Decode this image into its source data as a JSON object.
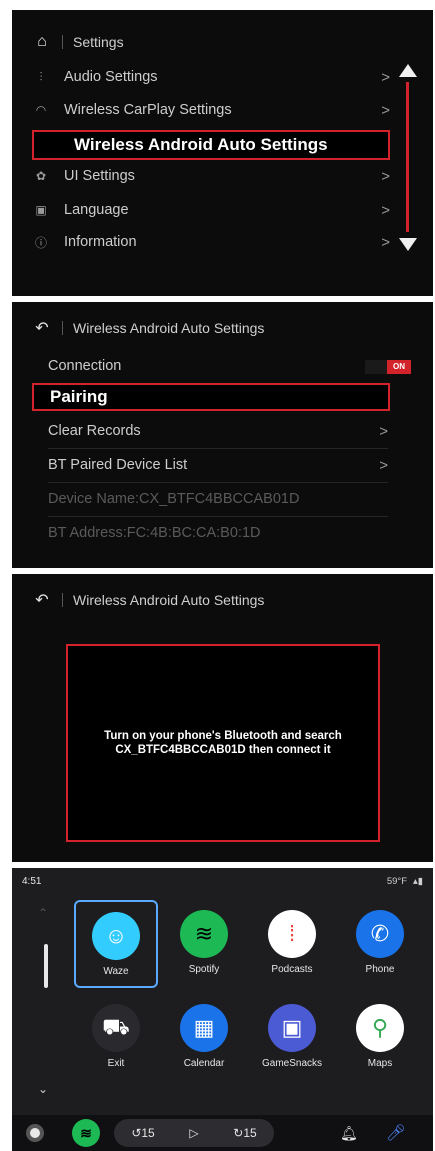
{
  "settings_panel": {
    "title": "Settings",
    "items": [
      {
        "label": "Audio Settings",
        "icon": "audio-icon",
        "chevron": ">"
      },
      {
        "label": "Wireless CarPlay Settings",
        "icon": "wifi-icon",
        "chevron": ">"
      },
      {
        "label": "Wireless Android Auto Settings",
        "icon": "",
        "chevron": ""
      },
      {
        "label": "UI Settings",
        "icon": "palette-icon",
        "chevron": ">"
      },
      {
        "label": "Language",
        "icon": "language-icon",
        "chevron": ">"
      },
      {
        "label": "Information",
        "icon": "info-icon",
        "chevron": ">"
      }
    ]
  },
  "aa_settings_panel": {
    "title": "Wireless Android Auto Settings",
    "connection_label": "Connection",
    "connection_toggle": "ON",
    "pairing_label": "Pairing",
    "clear_records_label": "Clear Records",
    "bt_list_label": "BT Paired Device List",
    "device_name": "Device Name:CX_BTFC4BBCCAB01D",
    "bt_address": "BT Address:FC:4B:BC:CA:B0:1D",
    "chevron": ">"
  },
  "pairing_panel": {
    "title": "Wireless Android Auto Settings",
    "dialog_line1": "Turn on your phone's Bluetooth and search",
    "dialog_line2": "CX_BTFC4BBCCAB01D then connect it"
  },
  "android_auto": {
    "time": "4:51",
    "status_right": "59°F",
    "apps": [
      {
        "name": "Waze",
        "color": "#33ccff",
        "glyph": "☺"
      },
      {
        "name": "Spotify",
        "color": "#1db954",
        "glyph": "≋"
      },
      {
        "name": "Podcasts",
        "color": "#ffffff",
        "glyph": "⁞"
      },
      {
        "name": "Phone",
        "color": "#1a73e8",
        "glyph": "✆"
      },
      {
        "name": "Exit",
        "color": "#2a2a2e",
        "glyph": "⛟"
      },
      {
        "name": "Calendar",
        "color": "#1a73e8",
        "glyph": "▦"
      },
      {
        "name": "GameSnacks",
        "color": "#4a5bd4",
        "glyph": "▣"
      },
      {
        "name": "Maps",
        "color": "#ffffff",
        "glyph": "⚲"
      }
    ],
    "dock": {
      "rewind": "15",
      "play": "▷",
      "forward": "15"
    }
  }
}
